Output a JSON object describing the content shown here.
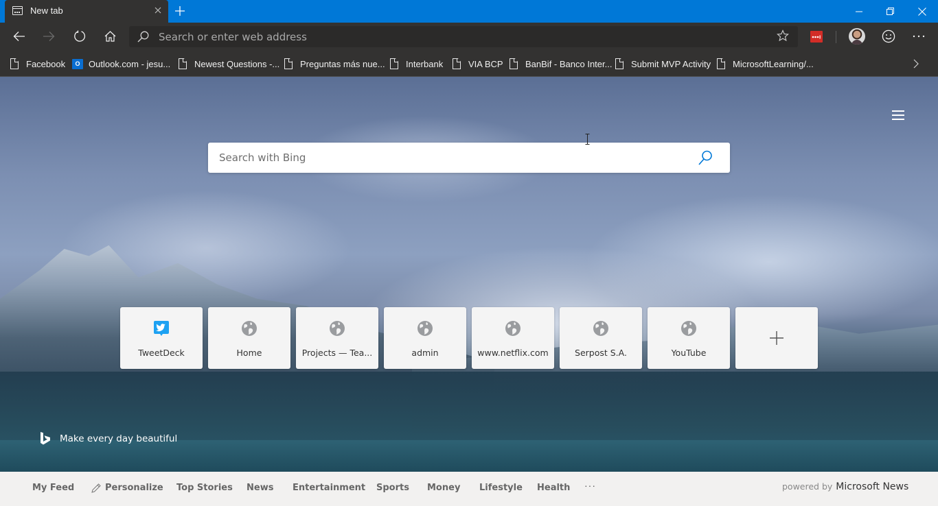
{
  "titlebar": {
    "tab_title": "New tab",
    "tab_icon": "new-tab-page-icon",
    "close_tab_icon": "close-icon",
    "new_tab_icon": "plus-icon",
    "window_controls": [
      "minimize-icon",
      "restore-icon",
      "close-icon"
    ],
    "accent_color": "#0078d7"
  },
  "toolbar": {
    "back_icon": "back-arrow-icon",
    "forward_icon": "forward-arrow-icon",
    "refresh_icon": "refresh-icon",
    "home_icon": "home-icon",
    "address_placeholder": "Search or enter web address",
    "address_value": "",
    "favorite_icon": "star-icon",
    "extension": "lastpass-icon",
    "profile": "avatar",
    "feedback_icon": "smiley-icon",
    "more_icon": "ellipsis-icon"
  },
  "favorites": [
    {
      "label": "Facebook",
      "icon": "document-icon"
    },
    {
      "label": "Outlook.com - jesu...",
      "icon": "outlook-icon"
    },
    {
      "label": "Newest Questions -...",
      "icon": "document-icon"
    },
    {
      "label": "Preguntas más nue...",
      "icon": "document-icon"
    },
    {
      "label": "Interbank",
      "icon": "document-icon"
    },
    {
      "label": "VIA BCP",
      "icon": "document-icon"
    },
    {
      "label": "BanBif - Banco Inter...",
      "icon": "document-icon"
    },
    {
      "label": "Submit MVP Activity",
      "icon": "document-icon"
    },
    {
      "label": "MicrosoftLearning/...",
      "icon": "document-icon"
    }
  ],
  "page": {
    "settings_icon": "hamburger-menu-icon",
    "search": {
      "placeholder": "Search with Bing",
      "value": "",
      "icon": "search-icon",
      "icon_color": "#0078d7"
    },
    "quick_links": [
      {
        "label": "TweetDeck",
        "icon": "tweetdeck-icon"
      },
      {
        "label": "Home",
        "icon": "globe-icon"
      },
      {
        "label": "Projects — Tea...",
        "icon": "globe-icon"
      },
      {
        "label": "admin",
        "icon": "globe-icon"
      },
      {
        "label": "www.netflix.com",
        "icon": "globe-icon"
      },
      {
        "label": "Serpost S.A.",
        "icon": "globe-icon"
      },
      {
        "label": "YouTube",
        "icon": "globe-icon"
      }
    ],
    "add_quick_link_icon": "plus-icon",
    "tagline": "Make every day beautiful"
  },
  "newsbar": {
    "items": [
      {
        "label": "My Feed"
      },
      {
        "label": "Personalize",
        "icon": "pencil-icon"
      },
      {
        "label": "Top Stories"
      },
      {
        "label": "News"
      },
      {
        "label": "Entertainment"
      },
      {
        "label": "Sports"
      },
      {
        "label": "Money"
      },
      {
        "label": "Lifestyle"
      },
      {
        "label": "Health"
      }
    ],
    "more": "···",
    "powered_by": "powered by",
    "brand": "Microsoft News"
  }
}
